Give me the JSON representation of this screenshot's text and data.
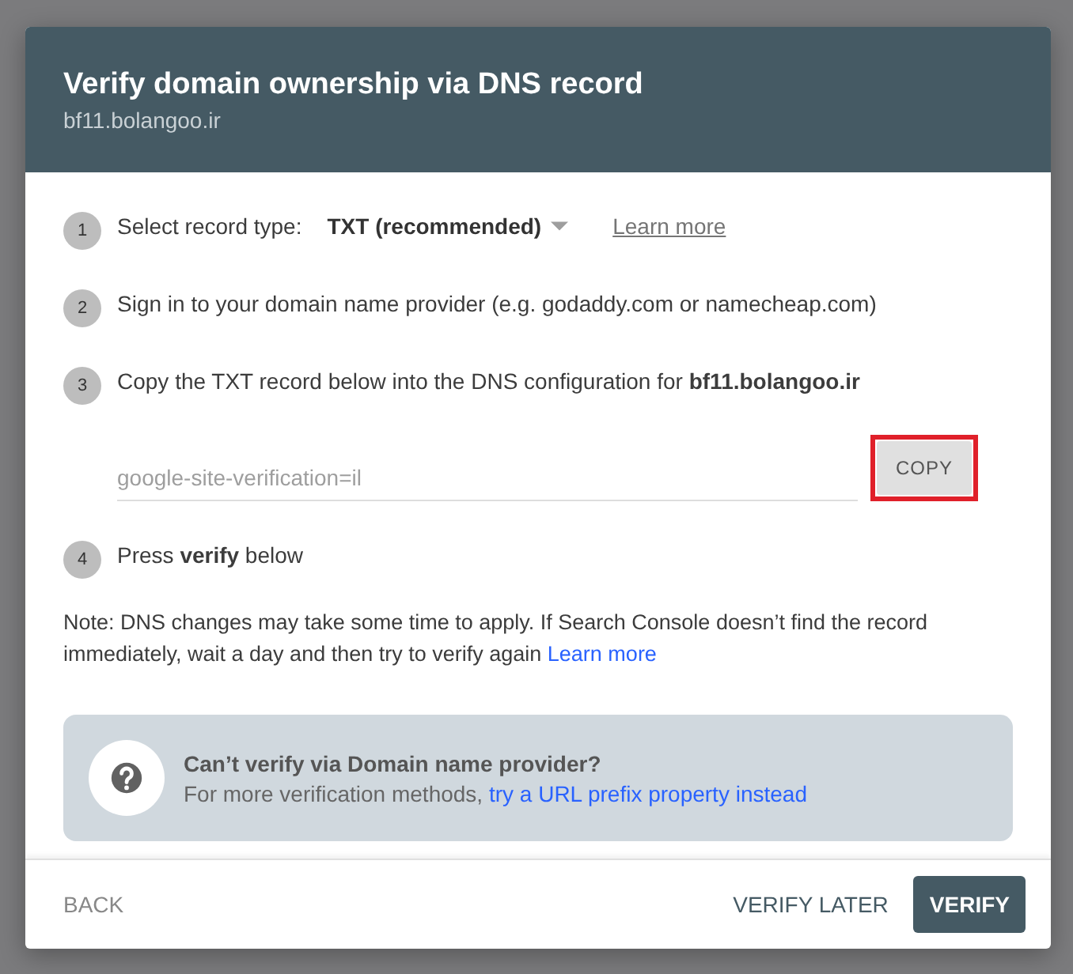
{
  "dialog": {
    "title": "Verify domain ownership via DNS record",
    "subtitle": "bf11.bolangoo.ir"
  },
  "steps": [
    {
      "kind": "select",
      "number": "1",
      "label": "Select record type:",
      "value": "TXT (recommended)",
      "link": "Learn more"
    },
    {
      "kind": "text",
      "number": "2",
      "text": "Sign in to your domain name provider (e.g. godaddy.com or namecheap.com)"
    },
    {
      "kind": "field",
      "number": "3",
      "text": "Copy the TXT record below into the DNS configuration for **bf11.bolangoo.ir**",
      "value": "google-site-verification=il",
      "button": {
        "label": "COPY",
        "highlighted": true
      }
    },
    {
      "kind": "text",
      "number": "4",
      "text": "Press **verify** below"
    }
  ],
  "note": {
    "text": "Note: DNS changes may take some time to apply. If Search Console doesn’t find the record immediately, wait a day and then try to verify again",
    "link": "Learn more"
  },
  "info": {
    "title": "Can’t verify via Domain name provider?",
    "text": "For more verification methods,",
    "link": "try a URL prefix property instead"
  },
  "footer": {
    "back": "BACK",
    "later": "VERIFY LATER",
    "verify": "VERIFY"
  }
}
